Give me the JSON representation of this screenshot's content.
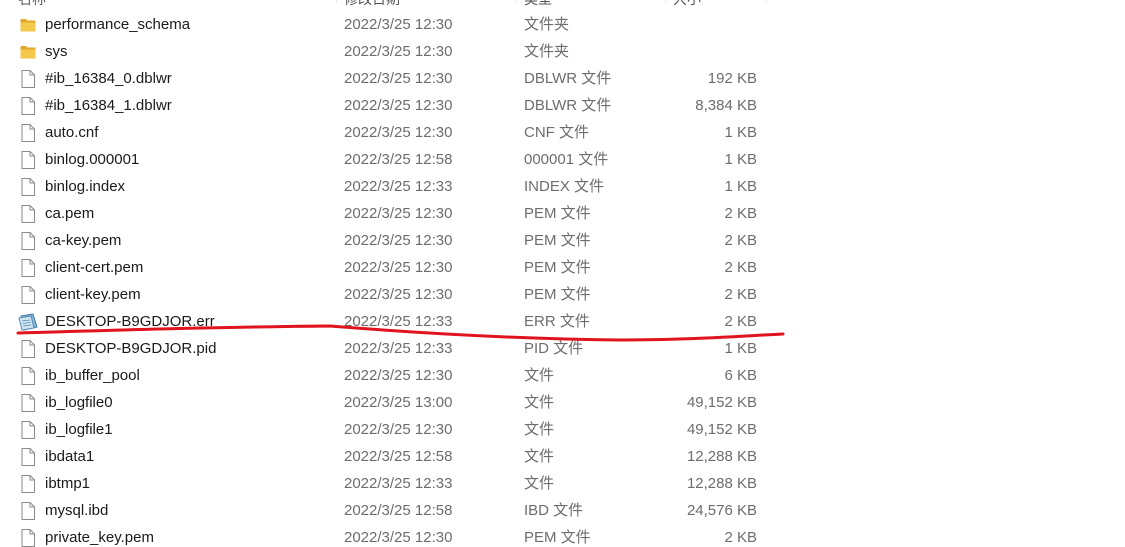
{
  "header": {
    "name": "名称",
    "date": "修改日期",
    "type": "类型",
    "size": "大小"
  },
  "rows": [
    {
      "name": "performance_schema",
      "date": "2022/3/25 12:30",
      "type": "文件夹",
      "size": "",
      "icon": "folder-icon"
    },
    {
      "name": "sys",
      "date": "2022/3/25 12:30",
      "type": "文件夹",
      "size": "",
      "icon": "folder-icon"
    },
    {
      "name": "#ib_16384_0.dblwr",
      "date": "2022/3/25 12:30",
      "type": "DBLWR 文件",
      "size": "192 KB",
      "icon": "file-icon"
    },
    {
      "name": "#ib_16384_1.dblwr",
      "date": "2022/3/25 12:30",
      "type": "DBLWR 文件",
      "size": "8,384 KB",
      "icon": "file-icon"
    },
    {
      "name": "auto.cnf",
      "date": "2022/3/25 12:30",
      "type": "CNF 文件",
      "size": "1 KB",
      "icon": "file-icon"
    },
    {
      "name": "binlog.000001",
      "date": "2022/3/25 12:58",
      "type": "000001 文件",
      "size": "1 KB",
      "icon": "file-icon"
    },
    {
      "name": "binlog.index",
      "date": "2022/3/25 12:33",
      "type": "INDEX 文件",
      "size": "1 KB",
      "icon": "file-icon"
    },
    {
      "name": "ca.pem",
      "date": "2022/3/25 12:30",
      "type": "PEM 文件",
      "size": "2 KB",
      "icon": "file-icon"
    },
    {
      "name": "ca-key.pem",
      "date": "2022/3/25 12:30",
      "type": "PEM 文件",
      "size": "2 KB",
      "icon": "file-icon"
    },
    {
      "name": "client-cert.pem",
      "date": "2022/3/25 12:30",
      "type": "PEM 文件",
      "size": "2 KB",
      "icon": "file-icon"
    },
    {
      "name": "client-key.pem",
      "date": "2022/3/25 12:30",
      "type": "PEM 文件",
      "size": "2 KB",
      "icon": "file-icon"
    },
    {
      "name": "DESKTOP-B9GDJOR.err",
      "date": "2022/3/25 12:33",
      "type": "ERR 文件",
      "size": "2 KB",
      "icon": "log-file-icon"
    },
    {
      "name": "DESKTOP-B9GDJOR.pid",
      "date": "2022/3/25 12:33",
      "type": "PID 文件",
      "size": "1 KB",
      "icon": "file-icon"
    },
    {
      "name": "ib_buffer_pool",
      "date": "2022/3/25 12:30",
      "type": "文件",
      "size": "6 KB",
      "icon": "file-icon"
    },
    {
      "name": "ib_logfile0",
      "date": "2022/3/25 13:00",
      "type": "文件",
      "size": "49,152 KB",
      "icon": "file-icon"
    },
    {
      "name": "ib_logfile1",
      "date": "2022/3/25 12:30",
      "type": "文件",
      "size": "49,152 KB",
      "icon": "file-icon"
    },
    {
      "name": "ibdata1",
      "date": "2022/3/25 12:58",
      "type": "文件",
      "size": "12,288 KB",
      "icon": "file-icon"
    },
    {
      "name": "ibtmp1",
      "date": "2022/3/25 12:33",
      "type": "文件",
      "size": "12,288 KB",
      "icon": "file-icon"
    },
    {
      "name": "mysql.ibd",
      "date": "2022/3/25 12:58",
      "type": "IBD 文件",
      "size": "24,576 KB",
      "icon": "file-icon"
    },
    {
      "name": "private_key.pem",
      "date": "2022/3/25 12:30",
      "type": "PEM 文件",
      "size": "2 KB",
      "icon": "file-icon"
    }
  ],
  "annotation": {
    "color": "#e0141e",
    "highlighted_row": "DESKTOP-B9GDJOR.err"
  },
  "colors": {
    "folder": "#f4c84a",
    "folder_dark": "#e2a82b",
    "file_outline": "#8a8a8a"
  }
}
